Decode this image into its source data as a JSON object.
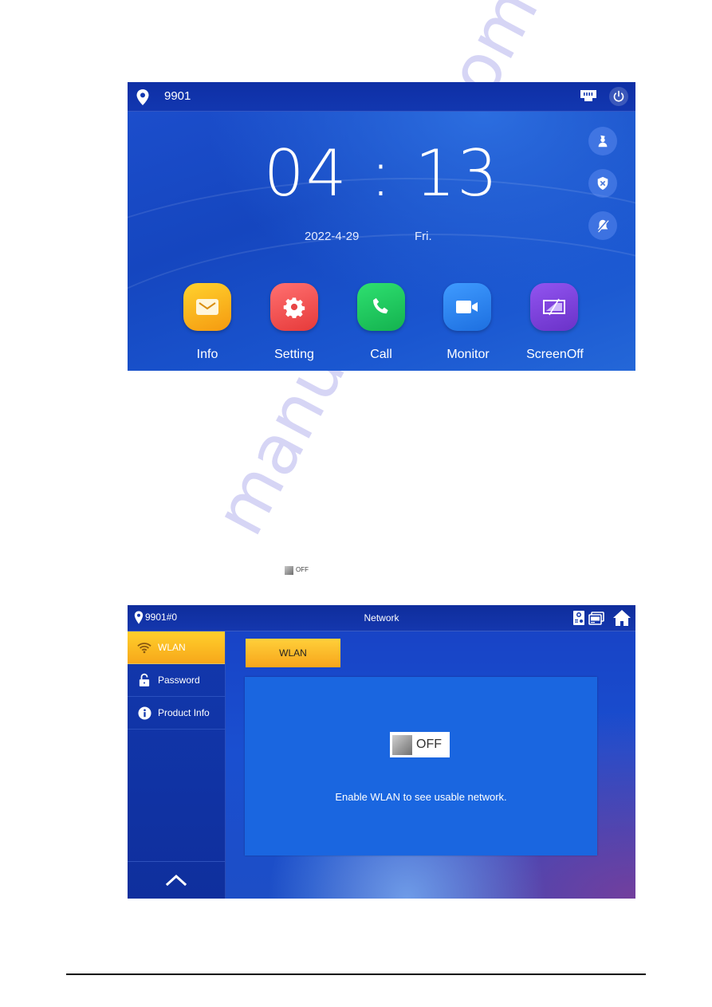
{
  "watermark": "manualshive.com",
  "home_screen": {
    "room_number": "9901",
    "status_icons": [
      "network-cable-icon",
      "power-icon"
    ],
    "side_buttons": [
      {
        "icon": "guard-station-icon"
      },
      {
        "icon": "arm-shield-icon"
      },
      {
        "icon": "dnd-mute-icon"
      }
    ],
    "clock": "04 : 13",
    "date": "2022-4-29",
    "weekday": "Fri.",
    "apps": [
      {
        "label": "Info",
        "icon": "mail-icon",
        "color": "#f9b21c"
      },
      {
        "label": "Setting",
        "icon": "gear-icon",
        "color": "#ea4b4b"
      },
      {
        "label": "Call",
        "icon": "phone-icon",
        "color": "#1ec55c"
      },
      {
        "label": "Monitor",
        "icon": "camera-icon",
        "color": "#2e86f0"
      },
      {
        "label": "ScreenOff",
        "icon": "screen-off-icon",
        "color": "#7b43d6"
      }
    ]
  },
  "inline_toggle": {
    "label": "OFF"
  },
  "network_screen": {
    "room_number": "9901#0",
    "title": "Network",
    "header_icons": [
      "door-station-icon",
      "monitor-windows-icon",
      "home-icon"
    ],
    "sidebar": [
      {
        "label": "WLAN",
        "icon": "wifi-icon",
        "active": true
      },
      {
        "label": "Password",
        "icon": "unlock-icon",
        "active": false
      },
      {
        "label": "Product Info",
        "icon": "info-icon",
        "active": false
      }
    ],
    "tab_label": "WLAN",
    "toggle_label": "OFF",
    "toggle_state": "off",
    "message": "Enable WLAN to see usable network.",
    "accent_color": "#f7a81a"
  }
}
